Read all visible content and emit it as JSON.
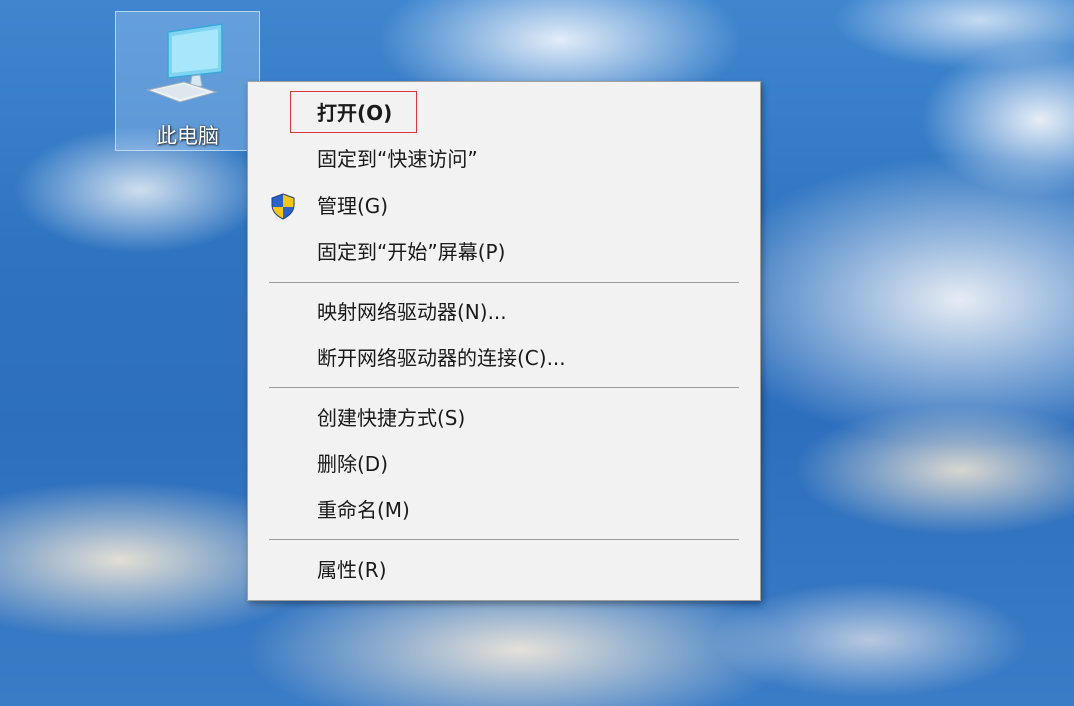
{
  "desktop": {
    "icon": {
      "label": "此电脑",
      "icon_name": "this-pc-icon"
    }
  },
  "context_menu": {
    "items": [
      {
        "label": "打开(O)",
        "bold": true,
        "highlighted": true
      },
      {
        "label": "固定到“快速访问”"
      },
      {
        "label": "管理(G)",
        "icon_name": "uac-shield-icon"
      },
      {
        "label": "固定到“开始”屏幕(P)"
      },
      {
        "label": "映射网络驱动器(N)..."
      },
      {
        "label": "断开网络驱动器的连接(C)..."
      },
      {
        "label": "创建快捷方式(S)"
      },
      {
        "label": "删除(D)"
      },
      {
        "label": "重命名(M)"
      },
      {
        "label": "属性(R)"
      }
    ]
  },
  "colors": {
    "highlight_border": "#d8383a",
    "menu_background": "#f2f2f2",
    "shield_blue": "#2a63c7",
    "shield_yellow": "#f5c518"
  }
}
